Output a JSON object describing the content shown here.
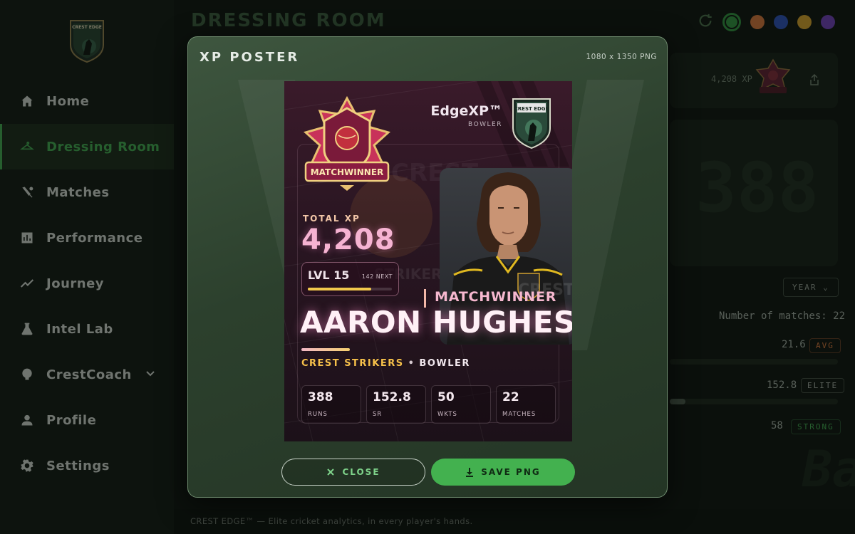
{
  "app": {
    "logo_text": "CREST EDGE",
    "page_title": "DRESSING ROOM",
    "footer": "CREST EDGE™ — Elite cricket analytics, in every player's hands."
  },
  "sidebar": {
    "items": [
      {
        "label": "Home",
        "icon": "home-icon"
      },
      {
        "label": "Dressing Room",
        "icon": "hanger-icon",
        "active": true
      },
      {
        "label": "Matches",
        "icon": "cricket-bat-icon"
      },
      {
        "label": "Performance",
        "icon": "bar-chart-icon"
      },
      {
        "label": "Journey",
        "icon": "trend-line-icon"
      },
      {
        "label": "Intel Lab",
        "icon": "flask-icon"
      },
      {
        "label": "CrestCoach",
        "icon": "coach-icon",
        "has_chevron": true
      },
      {
        "label": "Profile",
        "icon": "person-icon"
      },
      {
        "label": "Settings",
        "icon": "gear-icon"
      }
    ]
  },
  "theme_swatches": [
    "#2e8b3c",
    "#c8713a",
    "#2a4fb0",
    "#c99a2a",
    "#6a3fb0"
  ],
  "background": {
    "xp_value": "4,208 XP",
    "big_number": "388",
    "year_dropdown": "YEAR",
    "matches_label": "Number of matches: 22",
    "metrics": [
      {
        "value": "21.6",
        "badge": "AVG",
        "color": "#c8713a"
      },
      {
        "value": "152.8",
        "badge": "ELITE",
        "color": "#9aa39a"
      },
      {
        "value": "58",
        "badge": "STRONG",
        "color": "#3ea24d"
      }
    ],
    "watermark": "Bat"
  },
  "modal": {
    "title": "XP POSTER",
    "meta": "1080 x 1350 PNG",
    "close_label": "CLOSE",
    "save_label": "SAVE PNG"
  },
  "poster": {
    "badge_text": "MATCHWINNER",
    "brand": "EdgeXP™",
    "brand_role": "BOWLER",
    "crest_text": "CREST EDGE",
    "total_xp_label": "TOTAL XP",
    "total_xp": "4,208",
    "level": "LVL 15",
    "next": "142 NEXT",
    "level_progress": 0.75,
    "tag": "MATCHWINNER",
    "player_name": "AARON HUGHES",
    "team": "CREST STRIKERS",
    "separator": "•",
    "role": "BOWLER",
    "jersey_text": "CREST",
    "stats": [
      {
        "value": "388",
        "label": "RUNS"
      },
      {
        "value": "152.8",
        "label": "SR"
      },
      {
        "value": "50",
        "label": "WKTS"
      },
      {
        "value": "22",
        "label": "MATCHES"
      }
    ]
  }
}
